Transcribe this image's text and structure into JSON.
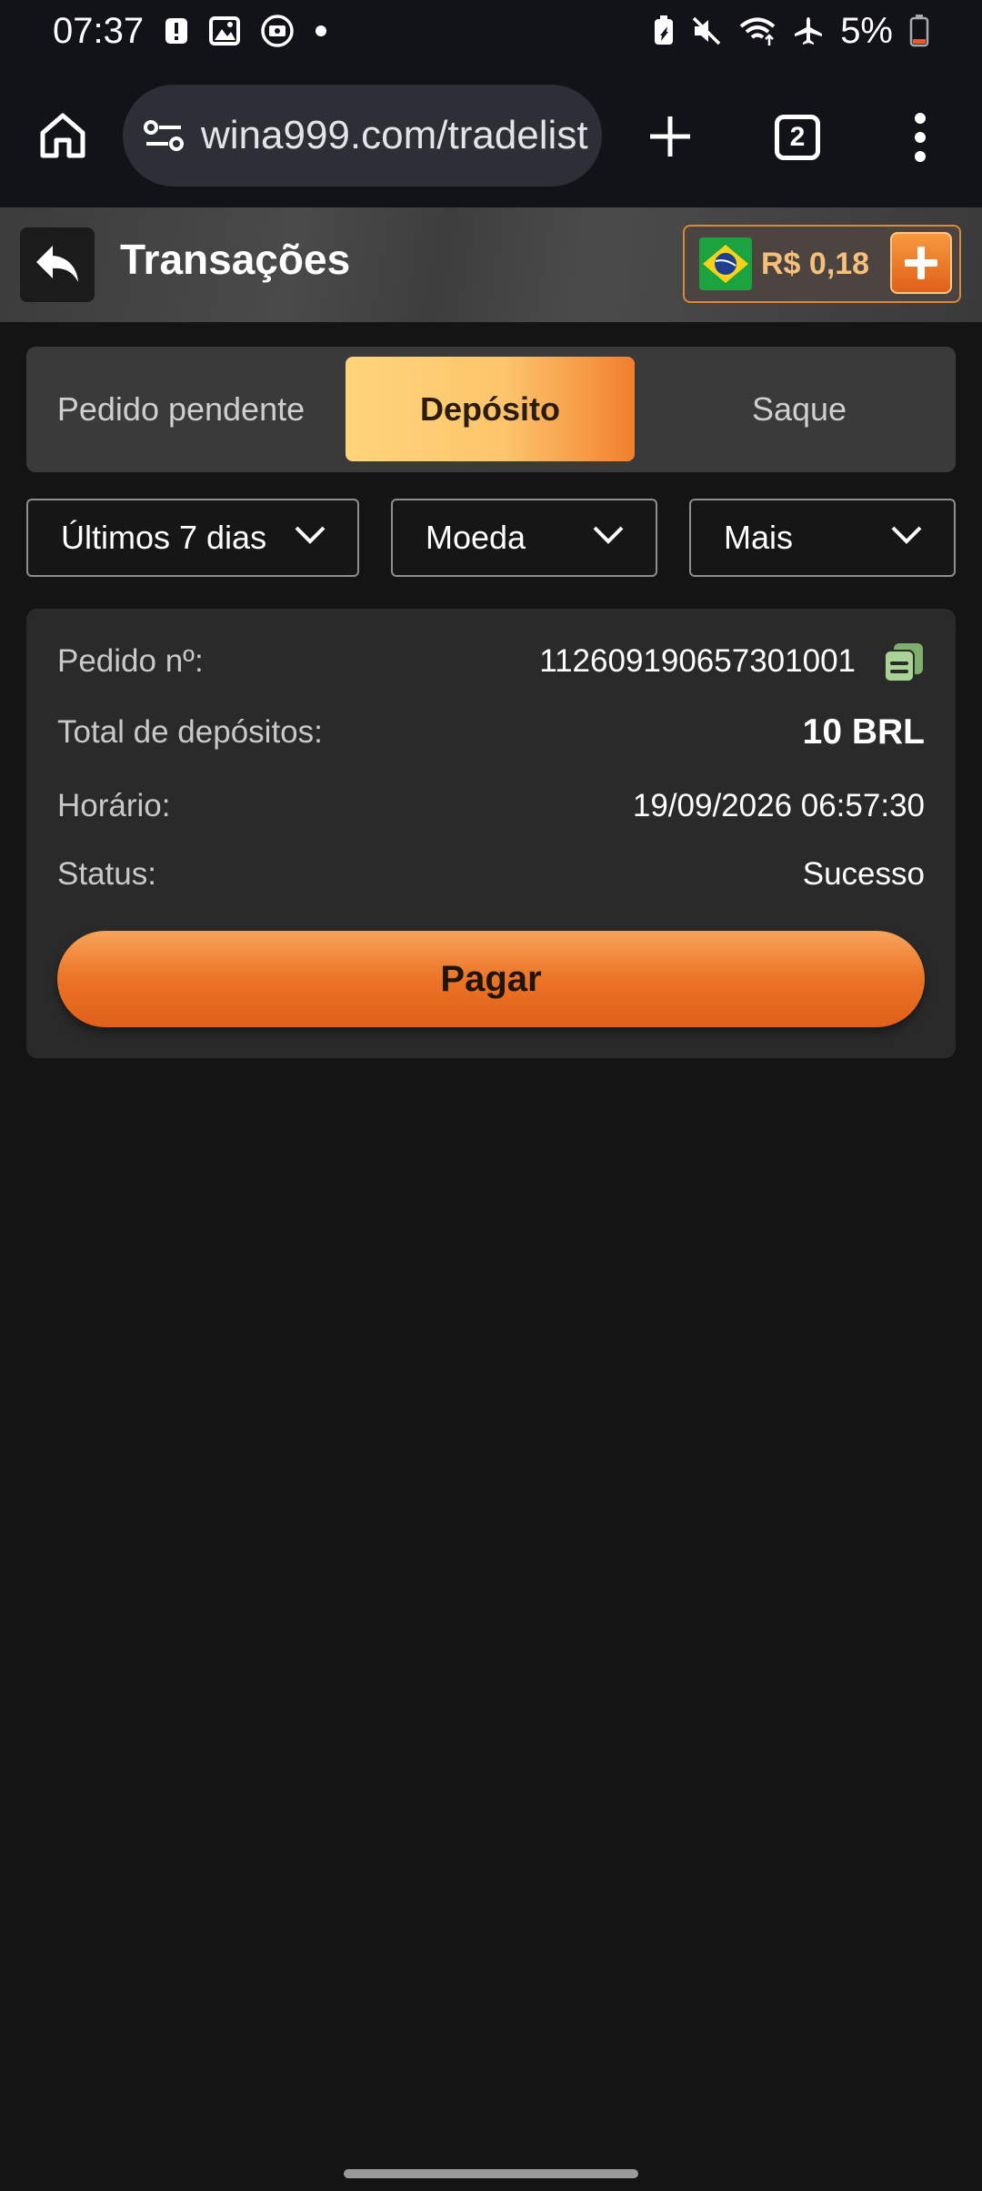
{
  "status_bar": {
    "time": "07:37",
    "battery": "5%",
    "icons": [
      "alert-icon",
      "image-icon",
      "screen-record-icon",
      "dot-icon",
      "battery-saver-icon",
      "mute-icon",
      "wifi-icon",
      "airplane-icon",
      "battery-icon"
    ]
  },
  "browser": {
    "url": "wina999.com/tradelist",
    "tab_count": "2"
  },
  "header": {
    "title": "Transações",
    "balance": "R$ 0,18"
  },
  "tabs": [
    {
      "label": "Pedido pendente",
      "active": false
    },
    {
      "label": "Depósito",
      "active": true
    },
    {
      "label": "Saque",
      "active": false
    }
  ],
  "filters": {
    "period": "Últimos 7 dias",
    "currency": "Moeda",
    "more": "Mais"
  },
  "order": {
    "order_label": "Pedido nº:",
    "order_number": "112609190657301001",
    "total_label": "Total de depósitos:",
    "total_value": "10 BRL",
    "time_label": "Horário:",
    "time_value": "19/09/2026 06:57:30",
    "status_label": "Status:",
    "status_value": "Sucesso",
    "pay_button": "Pagar"
  },
  "colors": {
    "accent": "#ec7426",
    "tab_active_start": "#ffd57a",
    "tab_active_end": "#f27f2e",
    "background": "#151414",
    "card": "#2a2a2a"
  }
}
